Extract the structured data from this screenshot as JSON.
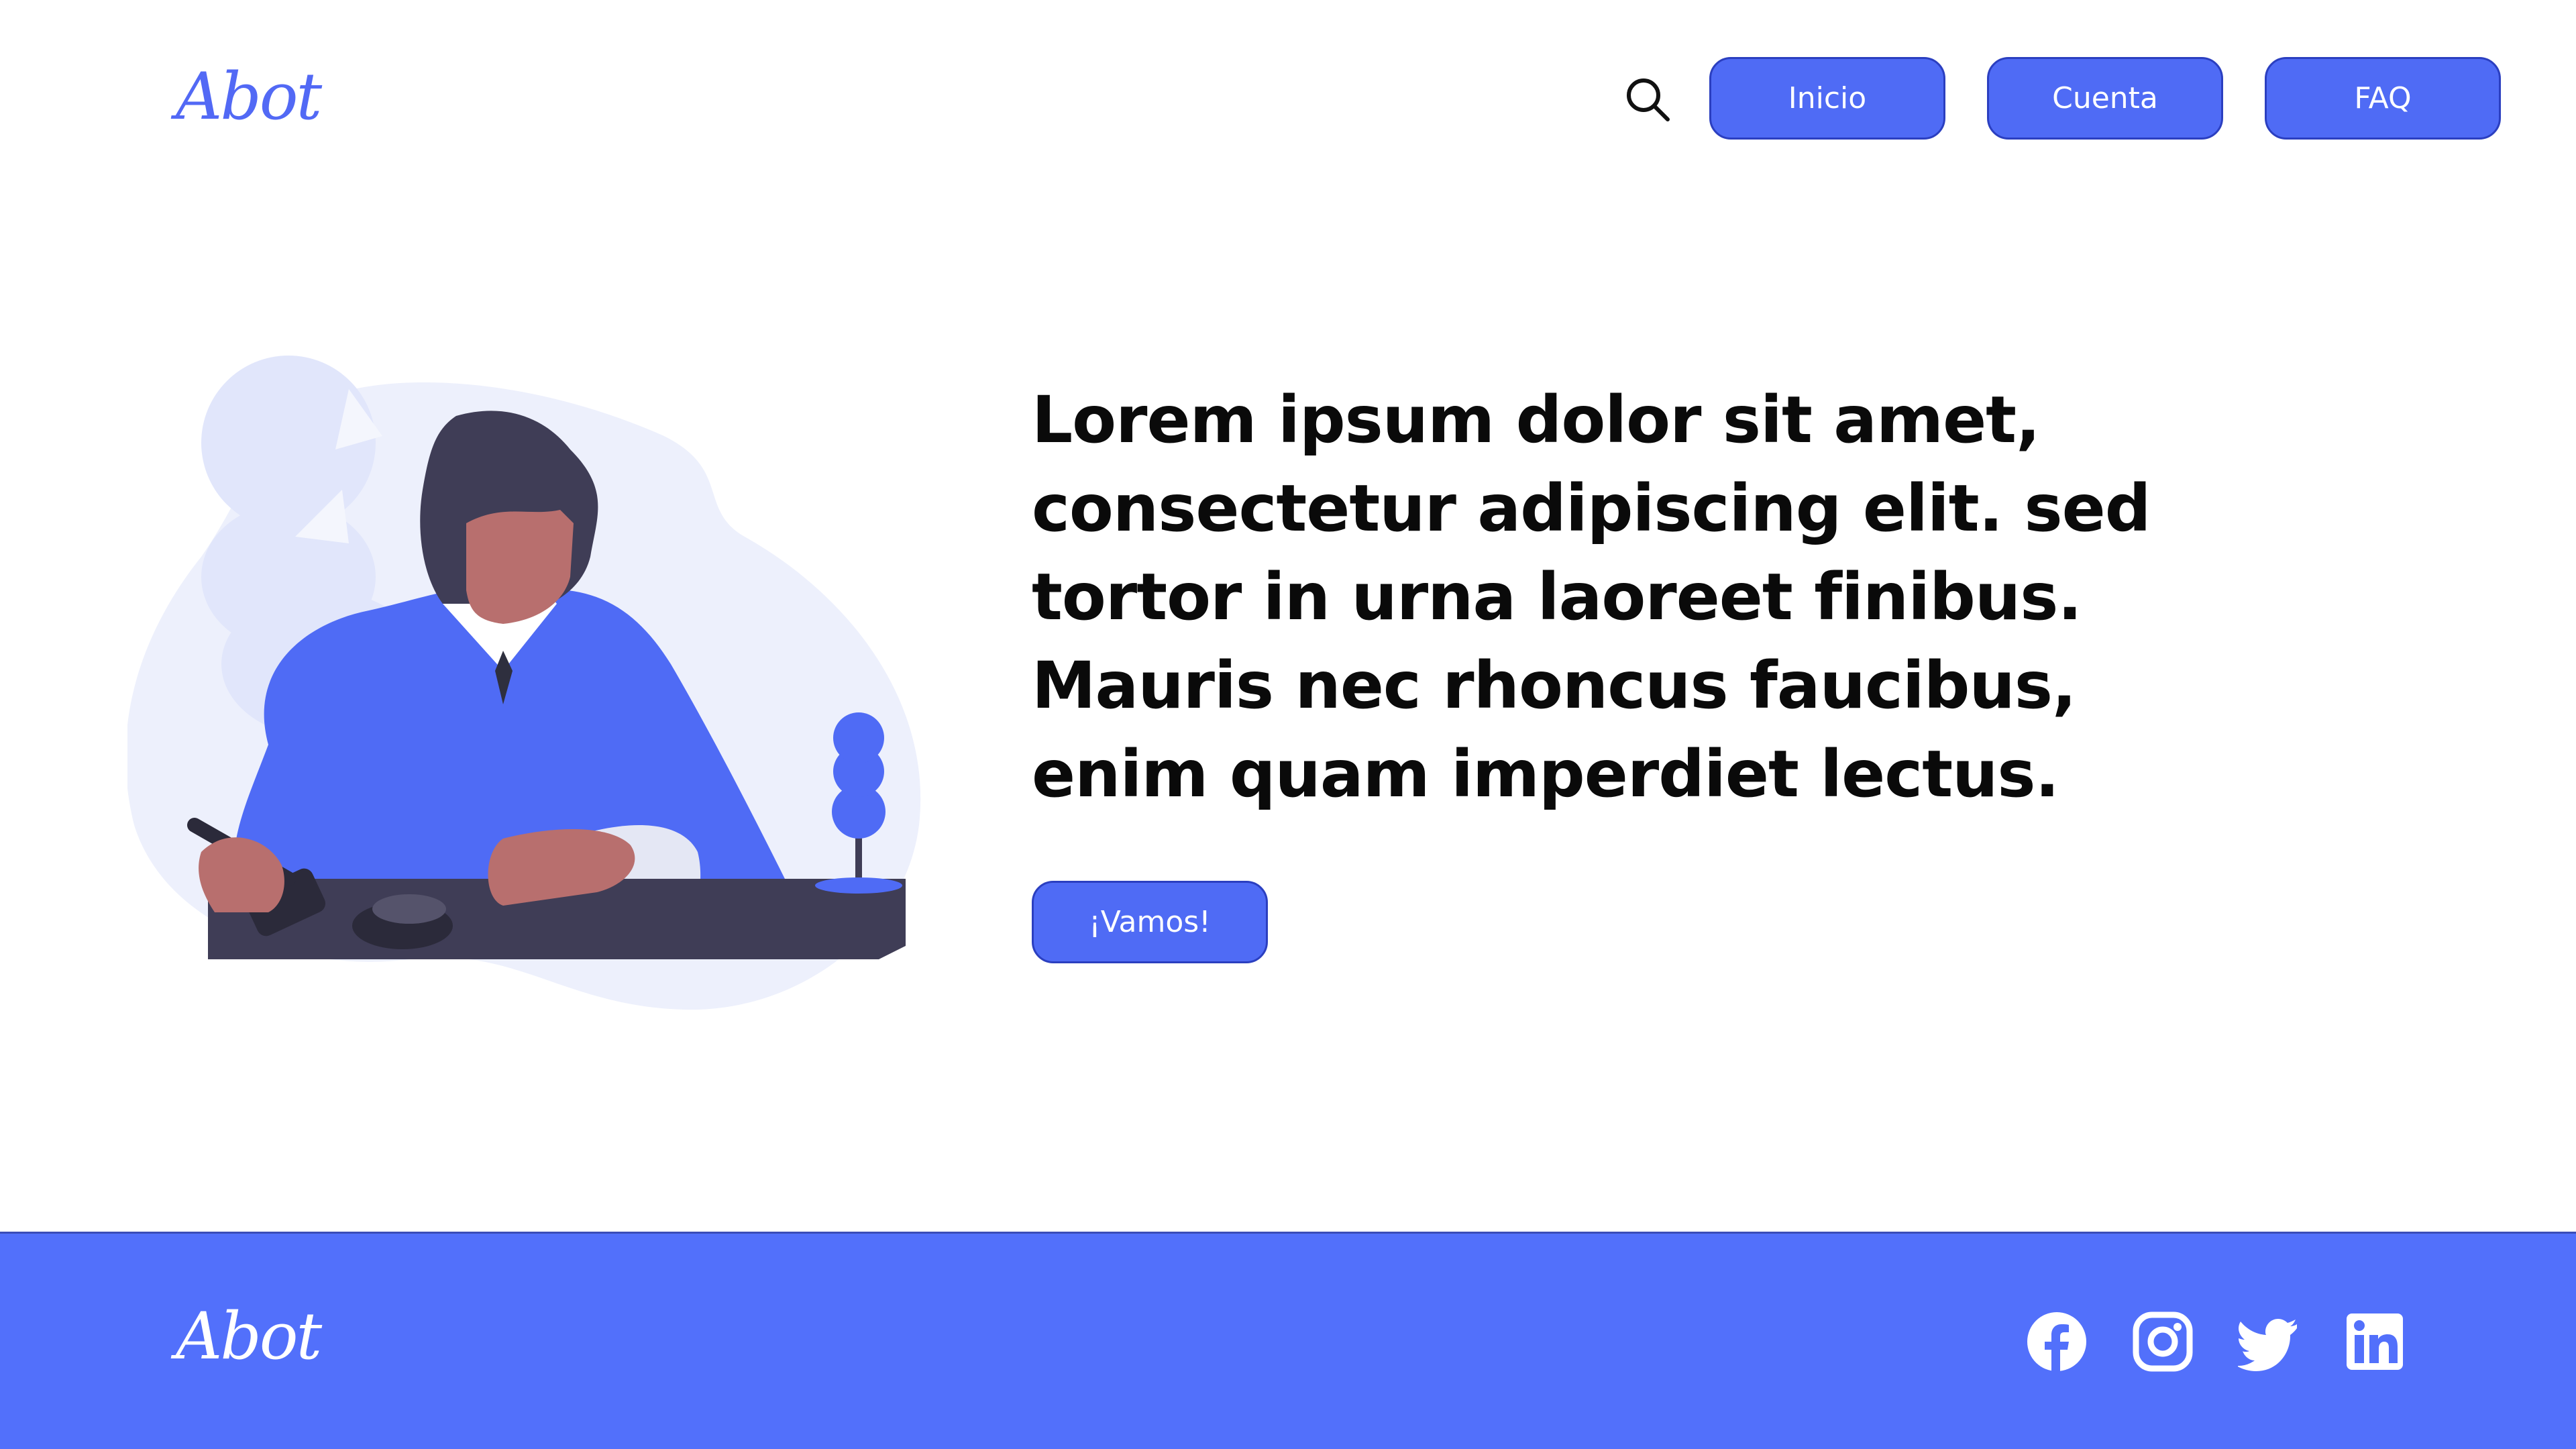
{
  "brand": {
    "name": "Abot"
  },
  "nav": {
    "items": [
      {
        "label": "Inicio"
      },
      {
        "label": "Cuenta"
      },
      {
        "label": "FAQ"
      }
    ],
    "search_icon": "search-icon"
  },
  "hero": {
    "headline_lines": [
      "Lorem ipsum dolor sit amet,",
      "consectetur adipiscing elit. sed",
      "tortor in urna laoreet finibus.",
      "Mauris nec rhoncus faucibus,",
      "enim quam imperdiet lectus."
    ],
    "cta_label": "¡Vamos!",
    "illustration": "judge-with-gavel-illustration"
  },
  "footer": {
    "social": [
      {
        "icon": "facebook-icon"
      },
      {
        "icon": "instagram-icon"
      },
      {
        "icon": "twitter-icon"
      },
      {
        "icon": "linkedin-icon"
      }
    ]
  },
  "colors": {
    "accent": "#5269f5",
    "button": "#4f6bf5",
    "footer_bg": "#5270fb",
    "text": "#0a0a0a",
    "background": "#ffffff"
  }
}
